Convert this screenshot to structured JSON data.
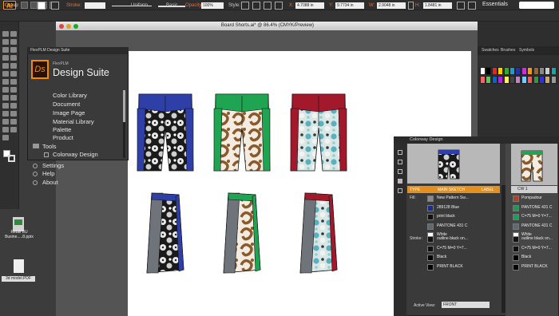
{
  "app": {
    "logo": "Ai",
    "workspace": "Essentials"
  },
  "controlbar": {
    "group_label": "Group",
    "stroke_label": "Stroke:",
    "uniform": "Uniform",
    "basic": "Basic",
    "opacity_label": "Opacity:",
    "opacity_value": "100%",
    "style_label": "Style:",
    "x_value": "4.7088 in",
    "y_value": "9.7734 in",
    "w_value": "2.9048 in",
    "h_value": "1.8481 in"
  },
  "document": {
    "title": "Board Shorts.ai* @ 86.4% (CMYK/Preview)"
  },
  "flexplm": {
    "panel_title": "FlexPLM Design Suite",
    "logo": "Ds",
    "subtitle": "FlexPLM",
    "name": "Design Suite",
    "items": [
      "Color Library",
      "Document",
      "Image Page",
      "Material Library",
      "Palette",
      "Product"
    ],
    "tools_label": "Tools",
    "colorway_design": "Colorway Design",
    "settings": "Settings",
    "help": "Help",
    "about": "About"
  },
  "swatches": {
    "tabs": [
      "Swatches",
      "Brushes",
      "Symbols"
    ]
  },
  "colorway": {
    "title": "Colorway Design",
    "col_type": "TYPE",
    "col_main": "MAIN SKETCH",
    "col_label": "LABEL",
    "cw_header": "CW 1",
    "fill_label": "Fill:",
    "stroke_label": "Stroke:",
    "fill_rows": [
      {
        "name": "New Pattern Sw...",
        "color": "#8a8a8a",
        "cw": "Pompadour",
        "cw_color": "#b0402a"
      },
      {
        "name": "289128 Blue",
        "color": "#1a2c8c",
        "cw": "PANTONE 431 C",
        "cw_color": "#1f9a52"
      },
      {
        "name": "print black",
        "color": "#111111",
        "cw": "C=75 M=0 Y=7...",
        "cw_color": "#1aa05a"
      },
      {
        "name": "PANTONE 431 C",
        "color": "#5e6a71",
        "cw": "PANTONE 431 C",
        "cw_color": "#5e6a71"
      },
      {
        "name": "White",
        "color": "#ffffff",
        "cw": "White",
        "cw_color": "#ffffff"
      }
    ],
    "stroke_rows": [
      {
        "name": "outline black on...",
        "color": "#111111",
        "cw": "outline black on...",
        "cw_color": "#111111"
      },
      {
        "name": "C=75 M=0 Y=7...",
        "color": "#111111",
        "cw": "C=75 M=0 Y=7...",
        "cw_color": "#111111"
      },
      {
        "name": "Black",
        "color": "#000000",
        "cw": "Black",
        "cw_color": "#000000"
      },
      {
        "name": "PRINT BLACK",
        "color": "#000000",
        "cw": "PRINT BLACK",
        "cw_color": "#000000"
      }
    ],
    "active_view_label": "Active View:",
    "active_view_value": "FRONT"
  },
  "desktop": {
    "file1": "Retail BU Busine.....8.pptx",
    "file2": "3d model.PDF"
  },
  "shorts": {
    "front": [
      {
        "waist": "#2e3fa8",
        "side": "#2e3fa8",
        "pattern": "floral-bw"
      },
      {
        "waist": "#1fa552",
        "side": "#1fa552",
        "pattern": "swirl-brown"
      },
      {
        "waist": "#a3192c",
        "side": "#a3192c",
        "pattern": "floral-teal"
      }
    ],
    "side": [
      {
        "band": "#2e3fa8",
        "pattern": "floral-bw"
      },
      {
        "band": "#1fa552",
        "pattern": "swirl-brown"
      },
      {
        "band": "#a3192c",
        "pattern": "floral-teal"
      }
    ]
  },
  "colors": {
    "accent": "#e39020"
  }
}
